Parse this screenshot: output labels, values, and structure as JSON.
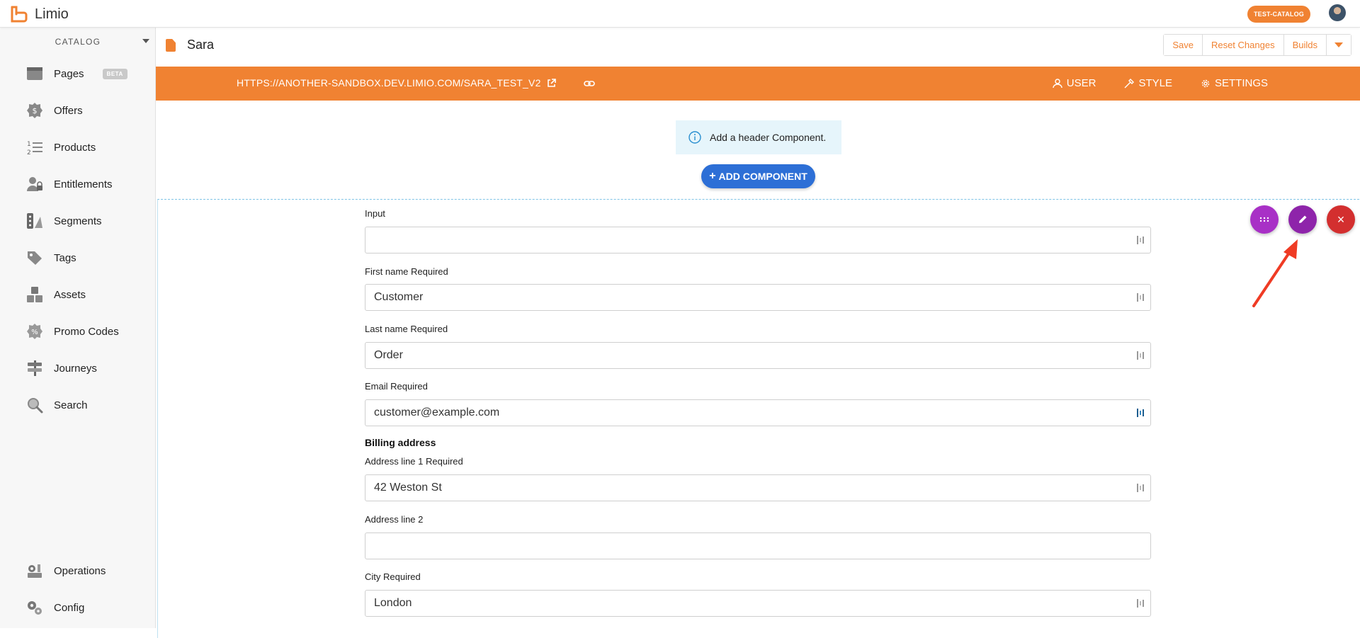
{
  "app": {
    "name": "Limio",
    "catalog_pill": "TEST-CATALOG"
  },
  "sidebar": {
    "section": "CATALOG",
    "items": [
      {
        "label": "Pages",
        "badge": "BETA",
        "icon": "pages-icon"
      },
      {
        "label": "Offers",
        "icon": "offers-icon"
      },
      {
        "label": "Products",
        "icon": "products-icon"
      },
      {
        "label": "Entitlements",
        "icon": "entitlements-icon"
      },
      {
        "label": "Segments",
        "icon": "segments-icon"
      },
      {
        "label": "Tags",
        "icon": "tag-icon"
      },
      {
        "label": "Assets",
        "icon": "assets-icon"
      },
      {
        "label": "Promo Codes",
        "icon": "promo-icon"
      },
      {
        "label": "Journeys",
        "icon": "signpost-icon"
      },
      {
        "label": "Search",
        "icon": "search-icon"
      }
    ],
    "bottom_items": [
      {
        "label": "Operations",
        "icon": "operations-icon"
      },
      {
        "label": "Config",
        "icon": "gears-icon"
      }
    ]
  },
  "header": {
    "title": "Sara",
    "buttons": {
      "save": "Save",
      "reset": "Reset Changes",
      "builds": "Builds"
    }
  },
  "orange_bar": {
    "url": "HTTPS://ANOTHER-SANDBOX.DEV.LIMIO.COM/SARA_TEST_V2",
    "user": "USER",
    "style": "STYLE",
    "settings": "SETTINGS"
  },
  "canvas": {
    "notice": "Add a header Component.",
    "add_button": "ADD COMPONENT"
  },
  "form": {
    "fields": [
      {
        "label": "Input",
        "value": ""
      },
      {
        "label": "First name Required",
        "value": "Customer"
      },
      {
        "label": "Last name Required",
        "value": "Order"
      },
      {
        "label": "Email Required",
        "value": "customer@example.com"
      }
    ],
    "billing_title": "Billing address",
    "billing_fields": [
      {
        "label": "Address line 1 Required",
        "value": "42 Weston St"
      },
      {
        "label": "Address line 2",
        "value": ""
      },
      {
        "label": "City Required",
        "value": "London"
      }
    ]
  },
  "colors": {
    "brand": "#f08232",
    "primary": "#2d6fd6",
    "edit_fab": "#8e24aa",
    "close_fab": "#d32f2f"
  }
}
